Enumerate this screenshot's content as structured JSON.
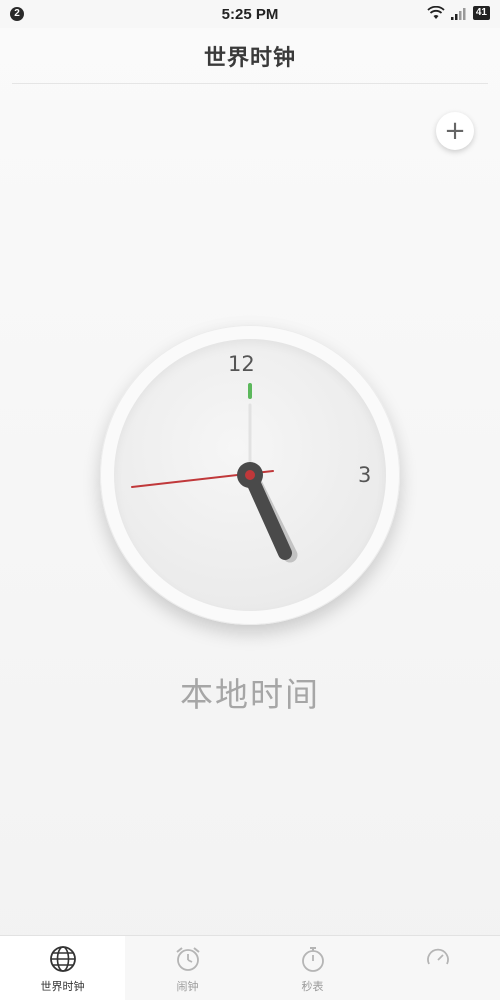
{
  "status_bar": {
    "notification_count": "2",
    "time": "5:25 PM",
    "battery": "41"
  },
  "header": {
    "title": "世界时钟"
  },
  "toolbar": {
    "add_label": "+"
  },
  "clock": {
    "numerals": [
      "12",
      "3"
    ],
    "time_shown": "5:25",
    "label": "本地时间"
  },
  "tabs": [
    {
      "label": "世界时钟",
      "icon": "globe-icon",
      "active": true
    },
    {
      "label": "闹钟",
      "icon": "alarm-clock-icon",
      "active": false
    },
    {
      "label": "秒表",
      "icon": "stopwatch-icon",
      "active": false
    },
    {
      "label": "",
      "icon": "timer-icon",
      "active": false
    }
  ],
  "colors": {
    "second_hand": "#c0383a",
    "twelve_marker": "#5cb85c",
    "hand": "#4a4a4a"
  }
}
